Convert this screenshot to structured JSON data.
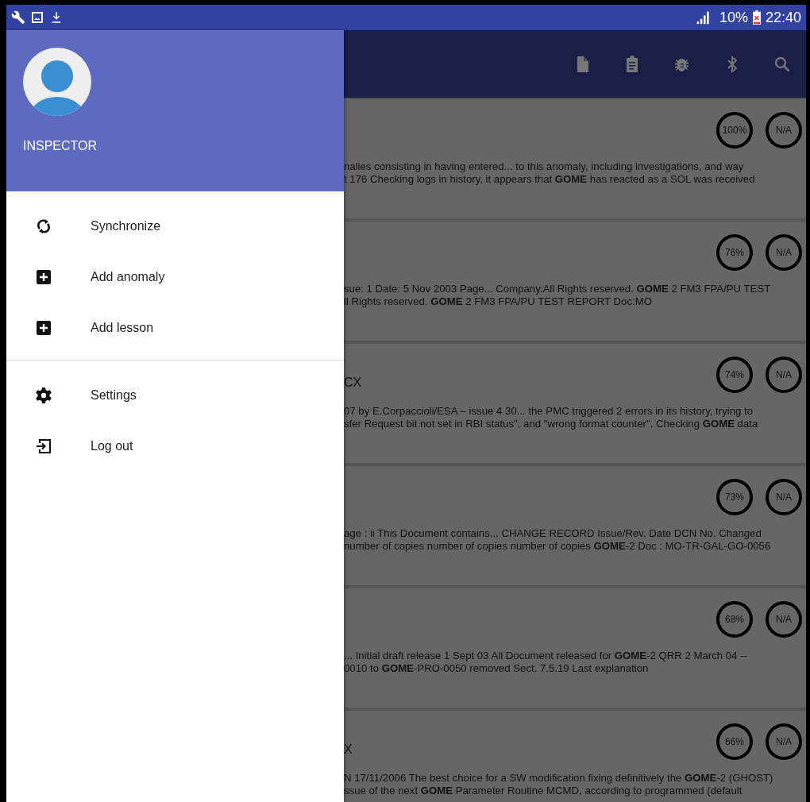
{
  "status_bar": {
    "battery": "10%",
    "time": "22:40"
  },
  "drawer": {
    "user": "INSPECTOR",
    "sections": [
      [
        {
          "kind": "sync",
          "label": "Synchronize"
        },
        {
          "kind": "add",
          "label": "Add anomaly"
        },
        {
          "kind": "add",
          "label": "Add lesson"
        }
      ],
      [
        {
          "kind": "settings",
          "label": "Settings"
        },
        {
          "kind": "logout",
          "label": "Log out"
        }
      ]
    ]
  },
  "cards": [
    {
      "score": "100%",
      "rating": "N/A",
      "lines": [
        "nalies consisting in having entered... to this anomaly, including investigations, and way",
        "t 176 Checking logs in history, it appears that **GOME** has reacted as a SOL was received"
      ]
    },
    {
      "score": "76%",
      "rating": "N/A",
      "lines": [
        "sue: 1 Date: 5 Nov 2003 Page... Company.All Rights reserved. **GOME** 2 FM3 FPA/PU TEST",
        "ll Rights reserved. **GOME** 2 FM3 FPA/PU TEST REPORT Doc:MO"
      ]
    },
    {
      "title": "CX",
      "score": "74%",
      "rating": "N/A",
      "lines": [
        "07 by E.Corpaccioli/ESA – issue 4 30... the PMC triggered 2 errors in its history, trying to",
        "sfer Request bit not set in RBI status\", and \"wrong format counter\". Checking **GOME** data"
      ]
    },
    {
      "score": "73%",
      "rating": "N/A",
      "lines": [
        "age : ii This Document contains... CHANGE RECORD Issue/Rev. Date DCN No. Changed",
        "number of copies number of copies number of copies **GOME**-2 Doc : MO-TR-GAL-GO-0056"
      ]
    },
    {
      "score": "68%",
      "rating": "N/A",
      "lines": [
        "... Initial draft release 1 Sept 03 All Document released for **GOME**-2 QRR 2 March 04 --",
        "0010 to **GOME**-PRO-0050 removed Sect. 7.5.19 Last explanation"
      ]
    },
    {
      "title": "X",
      "score": "66%",
      "rating": "N/A",
      "lines": [
        "N 17/11/2006 The best choice for a SW modification fixing definitively the **GOME**-2 (GHOST)",
        "ssue of the next **GOME** Parameter Routine MCMD, according to programmed (default"
      ]
    }
  ]
}
